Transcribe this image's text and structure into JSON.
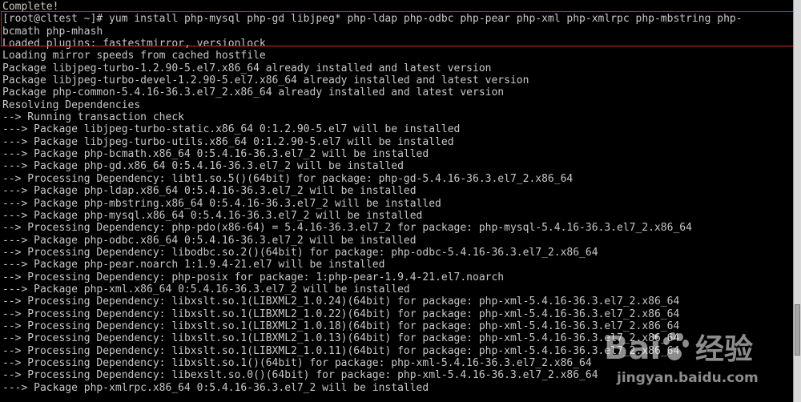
{
  "terminal": {
    "lines": [
      "Complete!",
      "[root@cltest ~]# yum install php-mysql php-gd libjpeg* php-ldap php-odbc php-pear php-xml php-xmlrpc php-mbstring php-",
      "bcmath php-mhash",
      "Loaded plugins: fastestmirror, versionlock",
      "Loading mirror speeds from cached hostfile",
      "Package libjpeg-turbo-1.2.90-5.el7.x86_64 already installed and latest version",
      "Package libjpeg-turbo-devel-1.2.90-5.el7.x86_64 already installed and latest version",
      "Package php-common-5.4.16-36.3.el7_2.x86_64 already installed and latest version",
      "Resolving Dependencies",
      "--> Running transaction check",
      "---> Package libjpeg-turbo-static.x86_64 0:1.2.90-5.el7 will be installed",
      "---> Package libjpeg-turbo-utils.x86_64 0:1.2.90-5.el7 will be installed",
      "---> Package php-bcmath.x86_64 0:5.4.16-36.3.el7_2 will be installed",
      "---> Package php-gd.x86_64 0:5.4.16-36.3.el7_2 will be installed",
      "--> Processing Dependency: libt1.so.5()(64bit) for package: php-gd-5.4.16-36.3.el7_2.x86_64",
      "---> Package php-ldap.x86_64 0:5.4.16-36.3.el7_2 will be installed",
      "---> Package php-mbstring.x86_64 0:5.4.16-36.3.el7_2 will be installed",
      "---> Package php-mysql.x86_64 0:5.4.16-36.3.el7_2 will be installed",
      "--> Processing Dependency: php-pdo(x86-64) = 5.4.16-36.3.el7_2 for package: php-mysql-5.4.16-36.3.el7_2.x86_64",
      "---> Package php-odbc.x86_64 0:5.4.16-36.3.el7_2 will be installed",
      "--> Processing Dependency: libodbc.so.2()(64bit) for package: php-odbc-5.4.16-36.3.el7_2.x86_64",
      "---> Package php-pear.noarch 1:1.9.4-21.el7 will be installed",
      "--> Processing Dependency: php-posix for package: 1:php-pear-1.9.4-21.el7.noarch",
      "---> Package php-xml.x86_64 0:5.4.16-36.3.el7_2 will be installed",
      "--> Processing Dependency: libxslt.so.1(LIBXML2_1.0.24)(64bit) for package: php-xml-5.4.16-36.3.el7_2.x86_64",
      "--> Processing Dependency: libxslt.so.1(LIBXML2_1.0.22)(64bit) for package: php-xml-5.4.16-36.3.el7_2.x86_64",
      "--> Processing Dependency: libxslt.so.1(LIBXML2_1.0.18)(64bit) for package: php-xml-5.4.16-36.3.el7_2.x86_64",
      "--> Processing Dependency: libxslt.so.1(LIBXML2_1.0.13)(64bit) for package: php-xml-5.4.16-36.3.el7_2.x86_64",
      "--> Processing Dependency: libxslt.so.1(LIBXML2_1.0.11)(64bit) for package: php-xml-5.4.16-36.3.el7_2.x86_64",
      "--> Processing Dependency: libxslt.so.1()(64bit) for package: php-xml-5.4.16-36.3.el7_2.x86_64",
      "--> Processing Dependency: libexslt.so.0()(64bit) for package: php-xml-5.4.16-36.3.el7_2.x86_64",
      "---> Package php-xmlrpc.x86_64 0:5.4.16-36.3.el7_2 will be installed"
    ]
  },
  "watermark": {
    "logo_text": "Bai 经验",
    "url": "jingyan.baidu.com"
  },
  "colors": {
    "background": "#000000",
    "text": "#c8c8c8",
    "highlight": "#d22b2b"
  }
}
